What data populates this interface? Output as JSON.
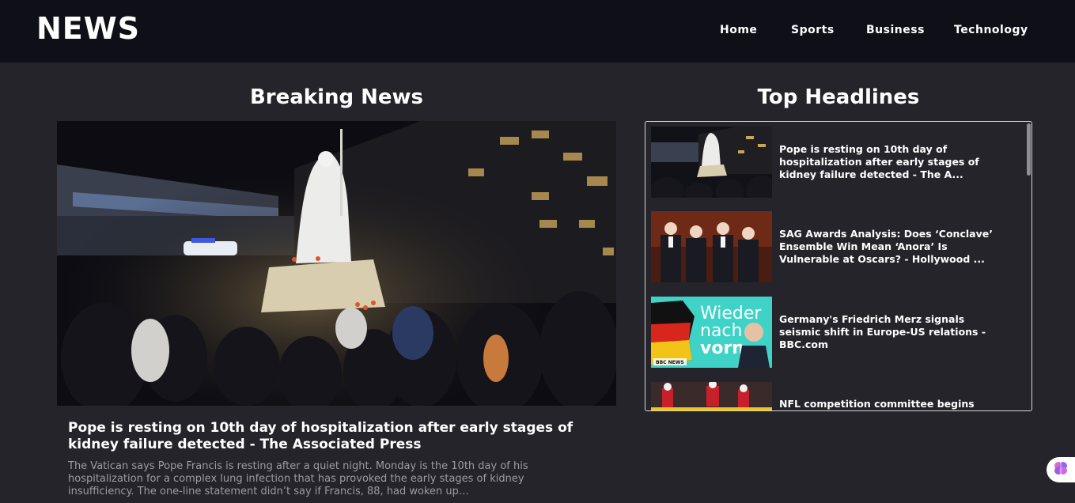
{
  "brand": {
    "logo_text": "NEWS"
  },
  "nav": {
    "links": [
      {
        "label": "Home"
      },
      {
        "label": "Sports"
      },
      {
        "label": "Business"
      },
      {
        "label": "Technology"
      }
    ]
  },
  "breaking": {
    "section_title": "Breaking News",
    "headline": "Pope is resting on 10th day of hospitalization after early stages of kidney failure detected - The Associated Press",
    "excerpt": "The Vatican says Pope Francis is resting after a quiet night. Monday is the 10th day of his hospitalization for a complex lung infection that has provoked the early stages of kidney insufficiency. The one-line statement didn’t say if Francis, 88, had woken up…"
  },
  "top_headlines": {
    "section_title": "Top Headlines",
    "items": [
      {
        "title": "Pope is resting on 10th day of hospitalization after early stages of kidney failure detected - The A..."
      },
      {
        "title": "SAG Awards Analysis: Does ‘Conclave’ Ensemble Win Mean ‘Anora’ Is Vulnerable at Oscars? - Hollywood ..."
      },
      {
        "title": "Germany's Friedrich Merz signals seismic shift in Europe-US relations - BBC.com",
        "thumb_text": [
          "Wieder",
          "nach",
          "vorn"
        ],
        "thumb_badge": "BBC NEWS"
      },
      {
        "title": "NFL competition committee begins mulling"
      }
    ]
  },
  "colors": {
    "navbar_bg": "#0f0f17",
    "page_bg": "#25242a",
    "excerpt_text": "#9c9ba2",
    "thumb_teal": "#3fd2c7"
  }
}
